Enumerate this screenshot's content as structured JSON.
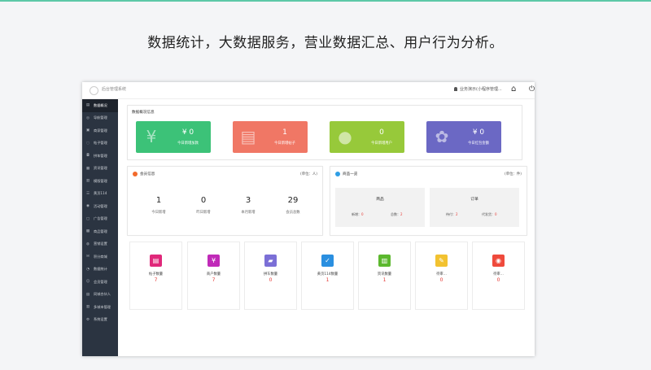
{
  "page": {
    "headline": "数据统计，大数据服务，营业数据汇总、用户行为分析。"
  },
  "topbar": {
    "app_title": "后台管理系统",
    "user_text": "业务演示(小程序管理..."
  },
  "sidebar": {
    "items": [
      {
        "label": "数据概况",
        "icon": "chart-icon",
        "active": true
      },
      {
        "label": "导航管理",
        "icon": "navigation-icon"
      },
      {
        "label": "商家管理",
        "icon": "store-icon"
      },
      {
        "label": "帖子管理",
        "icon": "comment-icon"
      },
      {
        "label": "拼车管理",
        "icon": "car-icon"
      },
      {
        "label": "资讯管理",
        "icon": "news-icon"
      },
      {
        "label": "模版管理",
        "icon": "template-icon"
      },
      {
        "label": "黄页114",
        "icon": "phonebook-icon"
      },
      {
        "label": "活动管理",
        "icon": "activity-icon"
      },
      {
        "label": "广告管理",
        "icon": "ad-icon"
      },
      {
        "label": "商品管理",
        "icon": "goods-icon"
      },
      {
        "label": "营销设置",
        "icon": "marketing-icon"
      },
      {
        "label": "积分商城",
        "icon": "points-icon"
      },
      {
        "label": "数据统计",
        "icon": "statistics-icon"
      },
      {
        "label": "会员管理",
        "icon": "member-icon"
      },
      {
        "label": "同城合伙人",
        "icon": "partner-icon"
      },
      {
        "label": "多城市管理",
        "icon": "city-icon"
      },
      {
        "label": "系统设置",
        "icon": "settings-icon"
      }
    ]
  },
  "overview": {
    "title": "数据概况信息",
    "cards": [
      {
        "value": "¥ 0",
        "label": "今日新增加款",
        "color": "#3cc278",
        "icon": "money-bag-icon"
      },
      {
        "value": "1",
        "label": "今日新增帖子",
        "color": "#f07765",
        "icon": "post-icon"
      },
      {
        "value": "0",
        "label": "今日新增用户",
        "color": "#97c93a",
        "icon": "chat-icon"
      },
      {
        "value": "¥ 0",
        "label": "今日红包金额",
        "color": "#6b68c4",
        "icon": "redpacket-icon"
      }
    ]
  },
  "members": {
    "title": "会员信息",
    "unit": "(单位：人)",
    "color": "#f26a2b",
    "stats": [
      {
        "value": "1",
        "label": "今日新增"
      },
      {
        "value": "0",
        "label": "昨日新增"
      },
      {
        "value": "3",
        "label": "本月新增"
      },
      {
        "value": "29",
        "label": "会员总数"
      }
    ]
  },
  "goods": {
    "title": "商品一览",
    "unit": "(单位：件)",
    "color": "#2f9ee5",
    "boxes": [
      {
        "title": "商品",
        "left_label": "新增：",
        "left_value": "0",
        "right_label": "总数：",
        "right_value": "2"
      },
      {
        "title": "订单",
        "left_label": "待付：",
        "left_value": "2",
        "right_label": "代发货：",
        "right_value": "0"
      }
    ]
  },
  "tiles": [
    {
      "label": "帖子数量",
      "value": "7",
      "color": "#e0287a",
      "icon": "document-icon"
    },
    {
      "label": "商户数量",
      "value": "7",
      "color": "#c02ab8",
      "icon": "bag-icon"
    },
    {
      "label": "拼车数量",
      "value": "0",
      "color": "#7b6fd6",
      "icon": "truck-icon"
    },
    {
      "label": "黄页114数量",
      "value": "1",
      "color": "#2a8fe0",
      "icon": "clipboard-icon"
    },
    {
      "label": "资讯数量",
      "value": "1",
      "color": "#5cb82e",
      "icon": "book-icon"
    },
    {
      "label": "待审...",
      "value": "0",
      "color": "#f2c230",
      "icon": "edit-icon"
    },
    {
      "label": "待审...",
      "value": "0",
      "color": "#ef4a3c",
      "icon": "target-icon"
    }
  ]
}
